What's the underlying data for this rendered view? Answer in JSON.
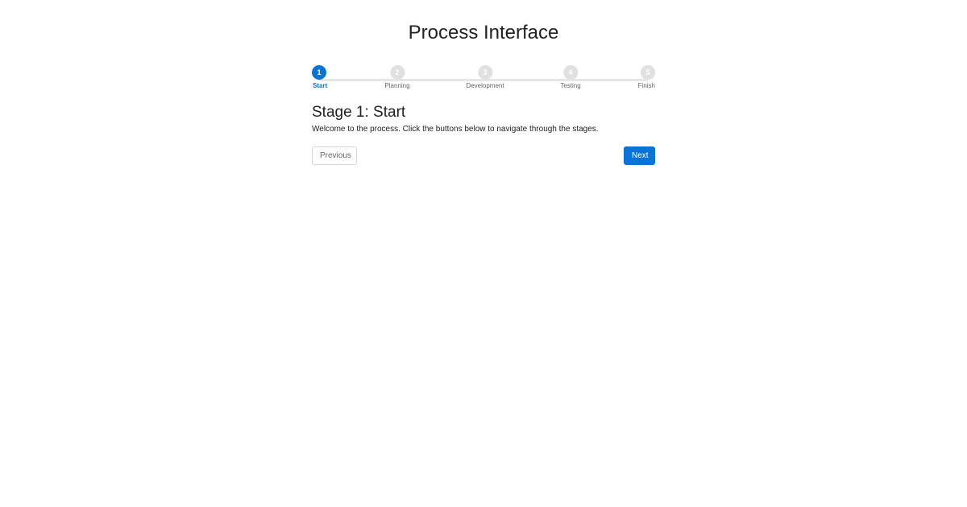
{
  "page": {
    "title": "Process Interface"
  },
  "stepper": {
    "active_index": 0,
    "steps": [
      {
        "number": "1",
        "label": "Start"
      },
      {
        "number": "2",
        "label": "Planning"
      },
      {
        "number": "3",
        "label": "Development"
      },
      {
        "number": "4",
        "label": "Testing"
      },
      {
        "number": "5",
        "label": "Finish"
      }
    ]
  },
  "stage": {
    "title": "Stage 1: Start",
    "description": "Welcome to the process. Click the buttons below to navigate through the stages."
  },
  "nav": {
    "previous_label": "Previous",
    "next_label": "Next"
  },
  "colors": {
    "accent": "#0a74d6",
    "inactive_step": "#e0e0e0"
  }
}
